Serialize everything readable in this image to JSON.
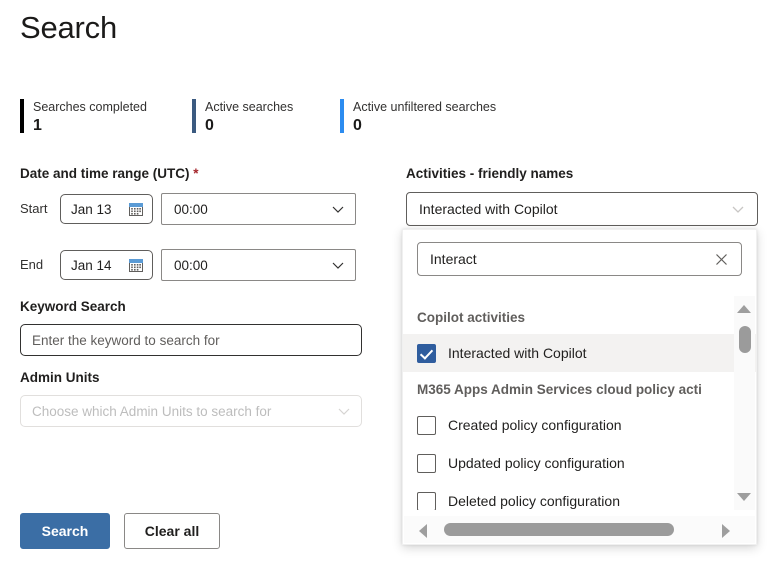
{
  "page": {
    "title": "Search"
  },
  "stats": [
    {
      "label": "Searches completed",
      "value": "1",
      "color": "#000000"
    },
    {
      "label": "Active searches",
      "value": "0",
      "color": "#3b5a80"
    },
    {
      "label": "Active unfiltered searches",
      "value": "0",
      "color": "#2c8cf0"
    }
  ],
  "date_range": {
    "label": "Date and time range (UTC)",
    "required_marker": "*",
    "start": {
      "row_label": "Start",
      "date_value": "Jan 13",
      "time_value": "00:00",
      "calendar_icon": "calendar-icon",
      "chevron_icon": "chevron-down-icon"
    },
    "end": {
      "row_label": "End",
      "date_value": "Jan 14",
      "time_value": "00:00",
      "calendar_icon": "calendar-icon",
      "chevron_icon": "chevron-down-icon"
    }
  },
  "keyword": {
    "label": "Keyword Search",
    "value": "",
    "placeholder": "Enter the keyword to search for"
  },
  "admin_units": {
    "label": "Admin Units",
    "placeholder": "Choose which Admin Units to search for",
    "chevron_icon": "chevron-down-icon",
    "disabled": true
  },
  "actions": {
    "search_label": "Search",
    "clear_label": "Clear all",
    "primary_color": "#3b6ea5"
  },
  "activities": {
    "label": "Activities - friendly names",
    "selected_text": "Interacted with Copilot",
    "chevron_icon": "chevron-down-icon",
    "dropdown": {
      "search_value": "Interact",
      "search_placeholder": "",
      "clear_icon": "close-icon",
      "groups": [
        {
          "header": "Copilot activities",
          "options": [
            {
              "label": "Interacted with Copilot",
              "checked": true,
              "highlighted": true
            }
          ]
        },
        {
          "header": "M365 Apps Admin Services cloud policy acti",
          "options": [
            {
              "label": "Created policy configuration",
              "checked": false,
              "highlighted": false
            },
            {
              "label": "Updated policy configuration",
              "checked": false,
              "highlighted": false
            },
            {
              "label": "Deleted policy configuration",
              "checked": false,
              "highlighted": false
            }
          ]
        }
      ],
      "vertical_scrollbar": {
        "up_arrow_icon": "scroll-up-arrow-icon",
        "down_arrow_icon": "scroll-down-arrow-icon"
      },
      "horizontal_scrollbar": {
        "left_arrow_icon": "scroll-left-arrow-icon",
        "right_arrow_icon": "scroll-right-arrow-icon"
      }
    }
  }
}
